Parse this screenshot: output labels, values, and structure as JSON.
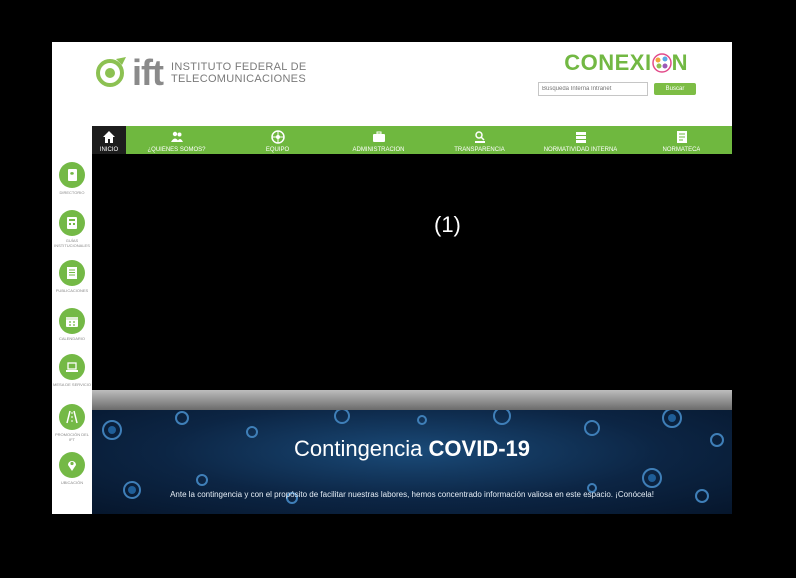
{
  "header": {
    "logo_text": "ift",
    "org_line1": "INSTITUTO FEDERAL DE",
    "org_line2": "TELECOMUNICACIONES",
    "portal_title": "CONEXI",
    "portal_title_end": "N"
  },
  "search": {
    "placeholder": "Búsqueda Interna Intranet",
    "button_label": "Buscar"
  },
  "nav": {
    "items": [
      {
        "label": "INICIO",
        "icon": "home-icon"
      },
      {
        "label": "¿QUIÉNES SOMOS?",
        "icon": "people-icon"
      },
      {
        "label": "EQUIPO",
        "icon": "network-icon"
      },
      {
        "label": "ADMINISTRACIÓN",
        "icon": "briefcase-icon"
      },
      {
        "label": "TRANSPARENCIA",
        "icon": "person-search-icon"
      },
      {
        "label": "NORMATIVIDAD INTERNA",
        "icon": "books-icon"
      },
      {
        "label": "NORMATECA",
        "icon": "document-icon"
      }
    ]
  },
  "sidebar": {
    "items": [
      {
        "label": "DIRECTORIO",
        "icon": "phonebook-icon"
      },
      {
        "label": "GUÍAS INSTITUCIONALES",
        "icon": "calculator-icon"
      },
      {
        "label": "PUBLICACIONES",
        "icon": "notebook-icon"
      },
      {
        "label": "CALENDARIO",
        "icon": "calendar-icon"
      },
      {
        "label": "MESA DE SERVICIO",
        "icon": "laptop-icon"
      },
      {
        "label": "PROMOCIÓN DEL IFT",
        "icon": "road-icon"
      },
      {
        "label": "UBICACIÓN",
        "icon": "location-pin-icon"
      }
    ]
  },
  "content": {
    "marker": "(1)"
  },
  "banner": {
    "title_regular": "Contingencia",
    "title_bold": "COVID-19",
    "subtitle": "Ante la contingencia y con el propósito de facilitar nuestras labores, hemos concentrado información valiosa en este espacio. ¡Conócela!"
  },
  "colors": {
    "accent_green": "#6fb83f",
    "banner_blue": "#0c2544",
    "background": "#000000"
  }
}
